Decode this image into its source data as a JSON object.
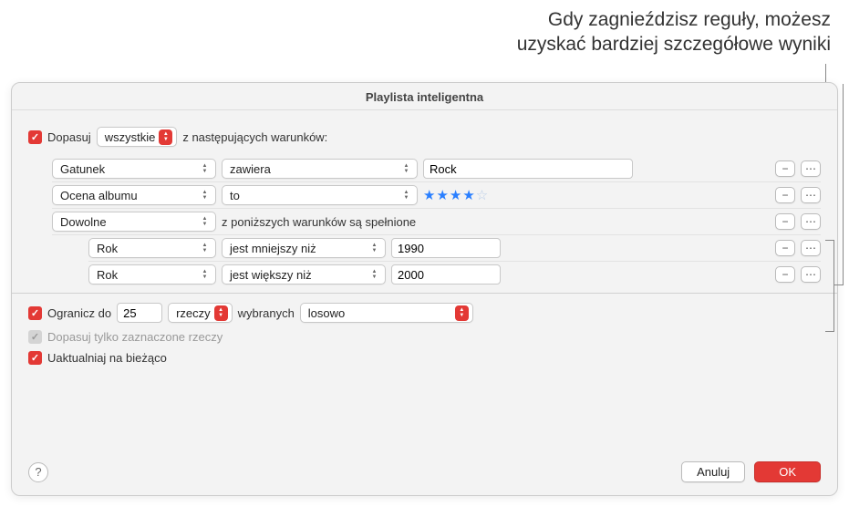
{
  "annotation": {
    "line1": "Gdy zagnieździsz reguły, możesz",
    "line2": "uzyskać bardziej szczegółowe wyniki"
  },
  "window": {
    "title": "Playlista inteligentna"
  },
  "match": {
    "checkbox_label": "Dopasuj",
    "mode": "wszystkie",
    "suffix": "z następujących warunków:"
  },
  "rules": [
    {
      "field": "Gatunek",
      "op": "zawiera",
      "value": "Rock"
    },
    {
      "field": "Ocena albumu",
      "op": "to",
      "stars": 4
    },
    {
      "field": "Dowolne",
      "suffix": "z poniższych warunków są spełnione"
    }
  ],
  "nested_rules": [
    {
      "field": "Rok",
      "op": "jest mniejszy niż",
      "value": "1990"
    },
    {
      "field": "Rok",
      "op": "jest większy niż",
      "value": "2000"
    }
  ],
  "limit": {
    "label": "Ogranicz do",
    "count": "25",
    "unit": "rzeczy",
    "selected_label": "wybranych",
    "mode": "losowo"
  },
  "only_checked": {
    "label": "Dopasuj tylko zaznaczone rzeczy"
  },
  "live_update": {
    "label": "Uaktualniaj na bieżąco"
  },
  "footer": {
    "cancel": "Anuluj",
    "ok": "OK"
  }
}
